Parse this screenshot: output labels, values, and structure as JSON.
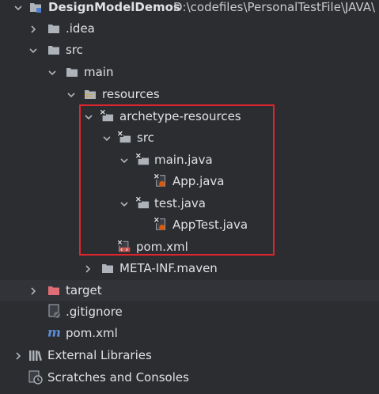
{
  "tree": {
    "root_name": "DesignModelDemos",
    "root_path": "D:\\codefiles\\PersonalTestFile\\JAVA\\",
    "idea": ".idea",
    "src": "src",
    "main": "main",
    "resources": "resources",
    "archetype_resources": "archetype-resources",
    "archetype_src": "src",
    "main_java": "main.java",
    "app_java": "App.java",
    "test_java": "test.java",
    "apptest_java": "AppTest.java",
    "inner_pom": "pom.xml",
    "meta_inf": "META-INF.maven",
    "target": "target",
    "gitignore": ".gitignore",
    "root_pom": "pom.xml",
    "external_libraries": "External Libraries",
    "scratches": "Scratches and Consoles"
  },
  "colors": {
    "background": "#2b2d30",
    "text": "#dfe1e5",
    "folder": "#aeb3b9",
    "excluded_folder": "#e06c75",
    "highlight_box": "#e0252c",
    "java_badge": "#d95a0f",
    "maven_icon": "#5c8dd6"
  },
  "icons": [
    "folder-icon",
    "module-icon",
    "resources-folder-icon",
    "unmarked-folder-icon",
    "java-file-icon",
    "xml-file-icon",
    "gitignore-icon",
    "maven-icon",
    "libraries-icon",
    "scratches-icon",
    "chevron-down-icon",
    "chevron-right-icon"
  ]
}
